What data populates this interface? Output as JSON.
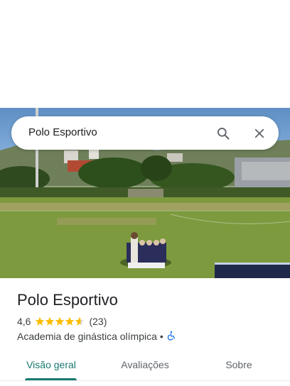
{
  "search": {
    "value": "Polo Esportivo",
    "search_icon": "search-icon",
    "clear_icon": "close-icon"
  },
  "place": {
    "name": "Polo Esportivo",
    "rating": "4,6",
    "rating_value": 4.6,
    "reviews": "(23)",
    "category": "Academia de ginástica olímpica",
    "separator": "•",
    "accessibility_icon": "wheelchair-icon"
  },
  "tabs": [
    {
      "label": "Visão geral",
      "active": true
    },
    {
      "label": "Avaliações",
      "active": false
    },
    {
      "label": "Sobre",
      "active": false
    }
  ],
  "colors": {
    "accent": "#1a7a70",
    "star": "#fbbc04",
    "accessibility": "#1a73e8"
  }
}
